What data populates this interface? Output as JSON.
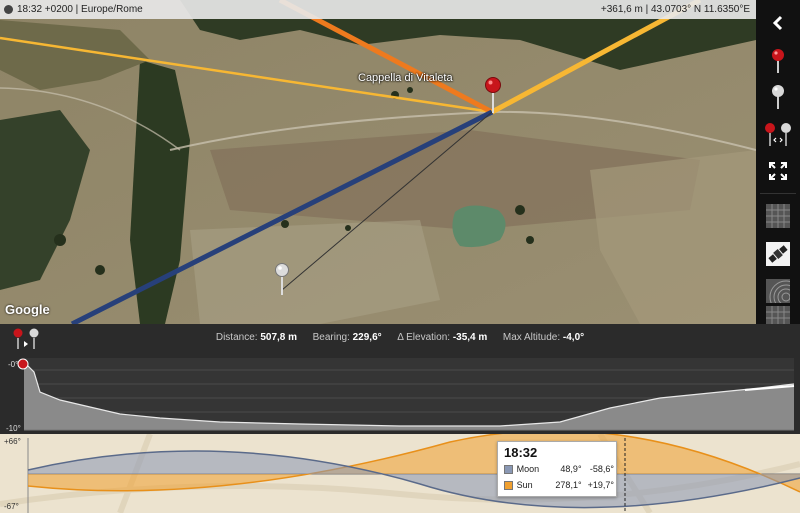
{
  "topbar": {
    "left_text": "18:32 +0200 | Europe/Rome",
    "right_text": "+361,6 m | 43.0703° N 11.6350°E"
  },
  "map": {
    "place_label": "Cappella di Vitaleta",
    "google_logo": "Google"
  },
  "sidebar": {
    "items": [
      {
        "name": "collapse",
        "icon": "chevron-left-icon"
      },
      {
        "name": "primary-pin",
        "icon": "red-pin-icon"
      },
      {
        "name": "secondary-pin",
        "icon": "grey-pin-icon"
      },
      {
        "name": "pin-pair",
        "icon": "pin-pair-icon"
      },
      {
        "name": "fullscreen",
        "icon": "expand-icon"
      },
      {
        "name": "grid-layer",
        "icon": "grid-icon"
      },
      {
        "name": "satellite-layer",
        "icon": "satellite-icon"
      },
      {
        "name": "terrain-layer",
        "icon": "terrain-icon"
      },
      {
        "name": "extra-layer",
        "icon": "grid-icon"
      }
    ]
  },
  "profile": {
    "distance_label": "Distance:",
    "distance_value": "507,8 m",
    "bearing_label": "Bearing:",
    "bearing_value": "229,6°",
    "elevation_label": "Δ Elevation:",
    "elevation_value": "-35,4 m",
    "maxalt_label": "Max Altitude:",
    "maxalt_value": "-4,0°",
    "y_top": "-0°",
    "y_bottom": "-10°"
  },
  "ephemeris": {
    "y_top": "+66°",
    "y_bottom": "-67°",
    "tooltip": {
      "time": "18:32",
      "moon_label": "Moon",
      "moon_azimuth": "48,9°",
      "moon_altitude": "-58,6°",
      "sun_label": "Sun",
      "sun_azimuth": "278,1°",
      "sun_altitude": "+19,7°"
    }
  },
  "colors": {
    "sun": "#f0a030",
    "moon": "#8a98b4",
    "sun_line": "#f7b733",
    "sunset_line": "#ee7a1e",
    "moon_line": "#27407a",
    "pin_red": "#c8151b"
  }
}
